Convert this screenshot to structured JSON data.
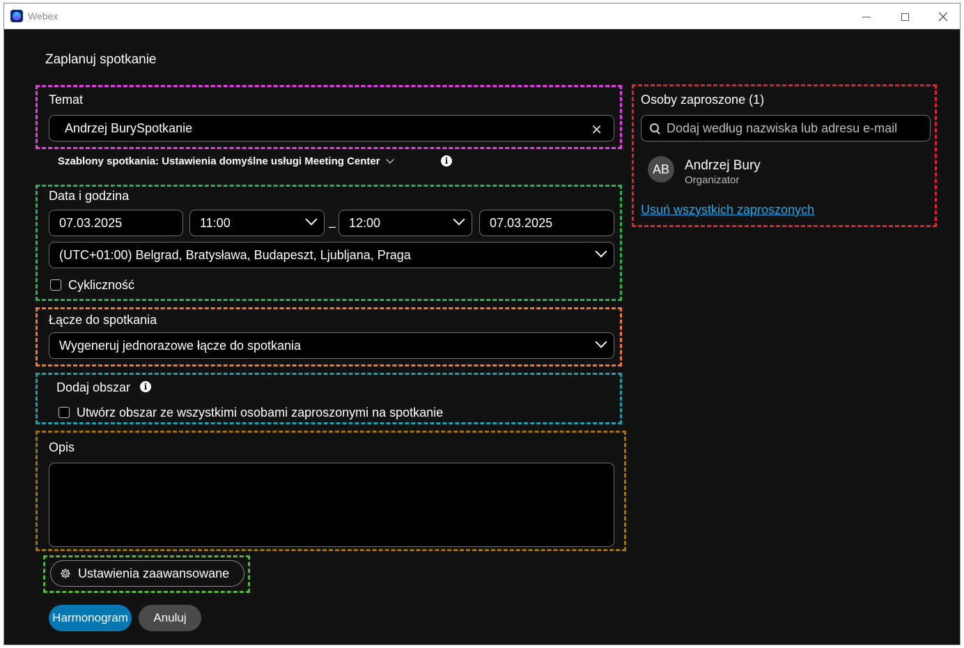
{
  "window": {
    "app_title": "Webex"
  },
  "page": {
    "title": "Zaplanuj spotkanie"
  },
  "topic": {
    "label": "Temat",
    "value": "Andrzej BurySpotkanie"
  },
  "template": {
    "text": "Szablony spotkania: Ustawienia domyślne usługi Meeting Center"
  },
  "datetime": {
    "label": "Data i godzina",
    "start_date": "07.03.2025",
    "start_time": "11:00",
    "separator": "–",
    "end_time": "12:00",
    "end_date": "07.03.2025",
    "timezone": "(UTC+01:00) Belgrad, Bratysława, Budapeszt, Ljubljana, Praga",
    "recurrence_label": "Cykliczność"
  },
  "meeting_link": {
    "label": "Łącze do spotkania",
    "value": "Wygeneruj jednorazowe łącze do spotkania"
  },
  "space": {
    "label": "Dodaj obszar",
    "checkbox_label": "Utwórz obszar ze wszystkimi osobami zaproszonymi na spotkanie"
  },
  "description": {
    "label": "Opis",
    "value": ""
  },
  "advanced": {
    "label": "Ustawienia zaawansowane"
  },
  "actions": {
    "schedule_label": "Harmonogram",
    "cancel_label": "Anuluj"
  },
  "invitees": {
    "label": "Osoby zaproszone (1)",
    "search_placeholder": "Dodaj według nazwiska lub adresu e-mail",
    "people": [
      {
        "initials": "AB",
        "name": "Andrzej Bury",
        "role": "Organizator"
      }
    ],
    "remove_all_label": "Usuń wszystkich zaproszonych"
  },
  "colors": {
    "background": "#121212",
    "primary_button": "#0878b4",
    "link": "#22a7e6",
    "annotation_magenta": "#e83ee8",
    "annotation_green": "#2ab24f",
    "annotation_orange": "#f07a35",
    "annotation_teal": "#1e9ea8",
    "annotation_olive": "#9c7314",
    "annotation_lime": "#56b43a",
    "annotation_red": "#e0222a"
  }
}
